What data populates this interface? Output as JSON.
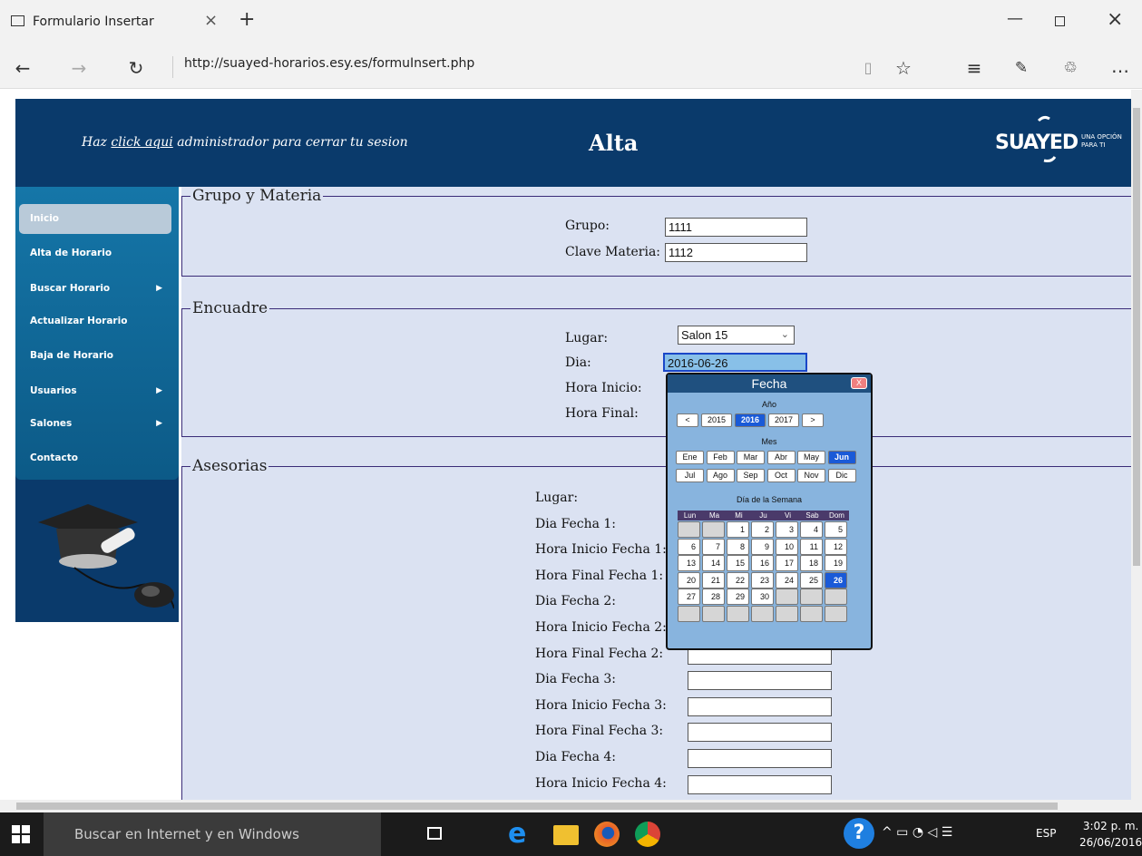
{
  "browser": {
    "tab_title": "Formulario Insertar",
    "url": "http://suayed-horarios.esy.es/formuInsert.php"
  },
  "header": {
    "prefix": "Haz ",
    "link": "click aqui",
    "suffix": " administrador para cerrar tu sesion",
    "title": "Alta",
    "logo_main": "SUAYED",
    "logo_tag1": "UNA OPCIÓN",
    "logo_tag2": "PARA TI"
  },
  "menu": {
    "items": [
      {
        "label": "Inicio"
      },
      {
        "label": "Alta de Horario"
      },
      {
        "label": "Buscar Horario"
      },
      {
        "label": "Actualizar Horario"
      },
      {
        "label": "Baja de Horario"
      },
      {
        "label": "Usuarios"
      },
      {
        "label": "Salones"
      },
      {
        "label": "Contacto"
      }
    ]
  },
  "grupo": {
    "legend": "Grupo y Materia",
    "grupo_label": "Grupo:",
    "grupo_value": "1111",
    "clave_label": "Clave Materia:",
    "clave_value": "1112"
  },
  "encuadre": {
    "legend": "Encuadre",
    "lugar_label": "Lugar:",
    "lugar_value": "Salon 15",
    "dia_label": "Dia:",
    "dia_value": "2016-06-26",
    "hinicio_label": "Hora Inicio:",
    "hfinal_label": "Hora Final:"
  },
  "asesorias": {
    "legend": "Asesorias",
    "labels": [
      "Lugar:",
      "Dia Fecha 1:",
      "Hora Inicio Fecha 1:",
      "Hora Final Fecha 1:",
      "Dia Fecha 2:",
      "Hora Inicio Fecha 2:",
      "Hora Final Fecha 2:",
      "Dia Fecha 3:",
      "Hora Inicio Fecha 3:",
      "Hora Final Fecha 3:",
      "Dia Fecha 4:",
      "Hora Inicio Fecha 4:"
    ]
  },
  "calendar": {
    "title": "Fecha",
    "close": "X",
    "year_label": "Año",
    "years": [
      "<",
      "2015",
      "2016",
      "2017",
      ">"
    ],
    "month_label": "Mes",
    "months": [
      "Ene",
      "Feb",
      "Mar",
      "Abr",
      "May",
      "Jun",
      "Jul",
      "Ago",
      "Sep",
      "Oct",
      "Nov",
      "Dic"
    ],
    "weekday_label": "Día de la Semana",
    "weekdays": [
      "Lun",
      "Ma",
      "Mi",
      "Ju",
      "Vi",
      "Sab",
      "Dom"
    ],
    "days": [
      "",
      "",
      "1",
      "2",
      "3",
      "4",
      "5",
      "6",
      "7",
      "8",
      "9",
      "10",
      "11",
      "12",
      "13",
      "14",
      "15",
      "16",
      "17",
      "18",
      "19",
      "20",
      "21",
      "22",
      "23",
      "24",
      "25",
      "26",
      "27",
      "28",
      "29",
      "30",
      "",
      "",
      "",
      "",
      "",
      "",
      "",
      "",
      "",
      ""
    ],
    "selected_year": "2016",
    "selected_month": "Jun",
    "selected_day": "26"
  },
  "taskbar": {
    "search_placeholder": "Buscar en Internet y en Windows",
    "lang": "ESP",
    "time": "3:02 p. m.",
    "date": "26/06/2016"
  }
}
